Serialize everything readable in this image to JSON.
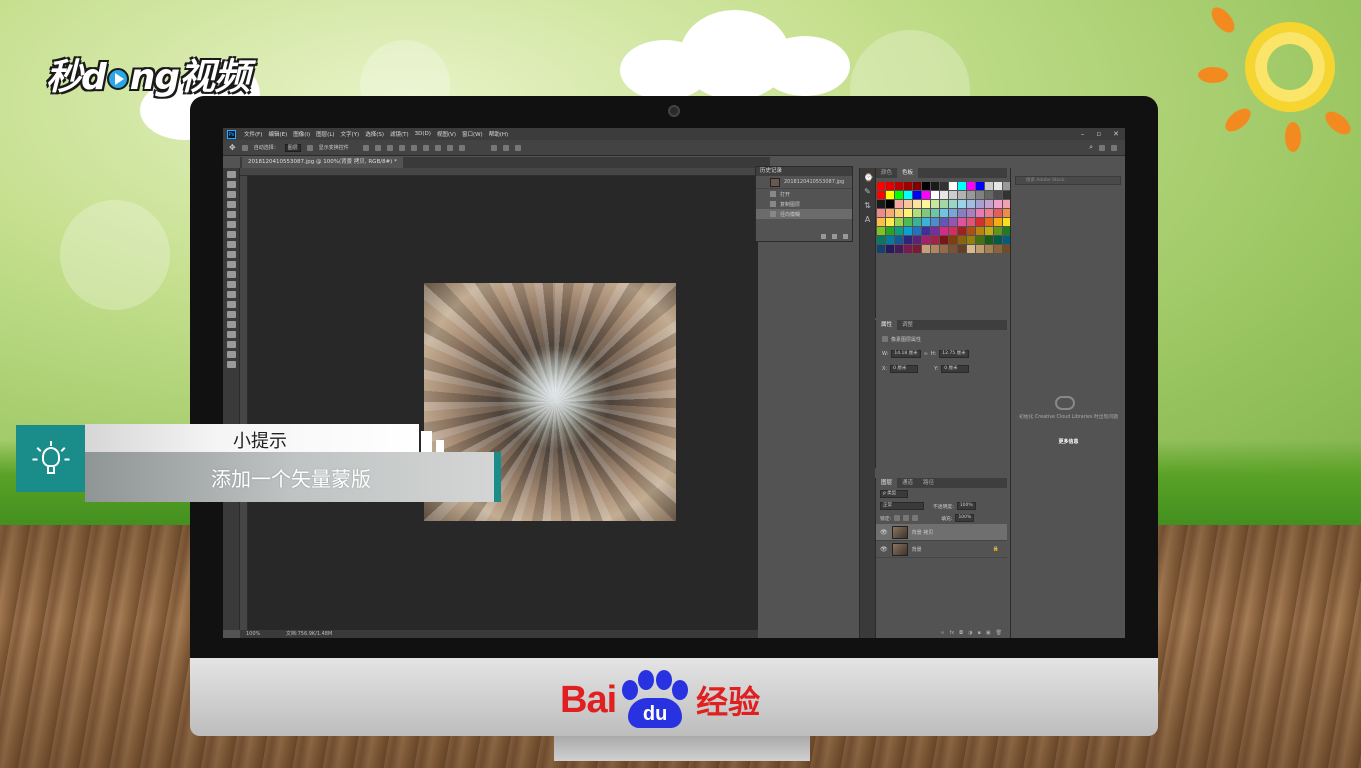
{
  "brand": {
    "logo_text_pre": "秒d",
    "logo_text_post": "ng视频",
    "baidu_left": "Bai",
    "baidu_paw": "du",
    "baidu_right": "经验"
  },
  "photoshop": {
    "menu": [
      "文件(F)",
      "编辑(E)",
      "图像(I)",
      "图层(L)",
      "文字(Y)",
      "选择(S)",
      "滤镜(T)",
      "3D(D)",
      "视图(V)",
      "窗口(W)",
      "帮助(H)"
    ],
    "window_controls": [
      "–",
      "▫",
      "✕"
    ],
    "options": {
      "auto_select_label": "自动选择：",
      "auto_select_value": "图层",
      "show_transform": "显示变换控件"
    },
    "document_tab": "20181204105530​87.jpg @ 100%(背景 拷贝, RGB/8#) *",
    "status": {
      "zoom": "100%",
      "doc_size": "文档:756.9K/1.48M"
    },
    "history": {
      "title": "历史记录",
      "snapshot": "2018120410553087.jpg",
      "steps": [
        "打开",
        "复制图层",
        "径向模糊"
      ],
      "active_step": 2
    },
    "swatches_tabs": [
      "颜色",
      "色板"
    ],
    "properties": {
      "tabs": [
        "属性",
        "调整"
      ],
      "section": "像素图层属性",
      "w_label": "W:",
      "w_value": "14.18 厘米",
      "h_label": "H:",
      "h_value": "12.75 厘米",
      "x_label": "X:",
      "x_value": "0 厘米",
      "y_label": "Y:",
      "y_value": "0 厘米",
      "link": "∞"
    },
    "layers": {
      "tabs": [
        "图层",
        "通道",
        "路径"
      ],
      "filter": "ρ 类型",
      "blend_mode": "正常",
      "opacity_label": "不透明度:",
      "opacity_value": "100%",
      "lock_label": "锁定:",
      "fill_label": "填充:",
      "fill_value": "100%",
      "items": [
        {
          "name": "背景 拷贝",
          "selected": true
        },
        {
          "name": "背景",
          "selected": false,
          "locked": true
        }
      ],
      "footer_icons": [
        "∞",
        "fx",
        "◘",
        "◑",
        "▪",
        "▣",
        "🗑"
      ]
    },
    "libraries": {
      "search_placeholder": "搜索 Adobe Stock",
      "message": "初始化 Creative Cloud Libraries 时出现问题",
      "link": "更多信息"
    }
  },
  "tip": {
    "title": "小提示",
    "text": "添加一个矢量蒙版"
  },
  "colors": {
    "teal_accent": "#1a8c8a",
    "baidu_red": "#e02020",
    "baidu_blue": "#2932e1",
    "ps_dark": "#535353"
  },
  "swatches": [
    "#ff0000",
    "#e00000",
    "#c00000",
    "#a00000",
    "#800000",
    "#000000",
    "#1a1a1a",
    "#333333",
    "#ffffff",
    "#00ffff",
    "#ff00ff",
    "#0000ff",
    "#cccccc",
    "#e6e6e6",
    "#999999",
    "#ff0000",
    "#ffff00",
    "#00ff00",
    "#00ffff",
    "#0000ff",
    "#ff00ff",
    "#ffffff",
    "#e6e6e6",
    "#cccccc",
    "#b3b3b3",
    "#999999",
    "#808080",
    "#666666",
    "#4d4d4d",
    "#333333",
    "#1a1a1a",
    "#000000",
    "#f5a3a3",
    "#f9c69b",
    "#fbe39c",
    "#fff59d",
    "#c9e7a1",
    "#a3d8a5",
    "#99d6c6",
    "#9bd4e9",
    "#a0bde4",
    "#a7a1d3",
    "#c5a0d0",
    "#eea2c9",
    "#f3a1b0",
    "#f08a8a",
    "#f6ab74",
    "#fbd177",
    "#fff078",
    "#b1dd7a",
    "#7fc97f",
    "#6cc6ac",
    "#6ec4e3",
    "#7aa5da",
    "#877ec4",
    "#ae7cc1",
    "#e77cb4",
    "#ec7c93",
    "#e65c5c",
    "#f28b46",
    "#f9c04a",
    "#ffeb4e",
    "#98d24f",
    "#52b852",
    "#3ab395",
    "#3bb2dc",
    "#4d8ccf",
    "#6457b3",
    "#9454b1",
    "#de529e",
    "#e35378",
    "#d42f2f",
    "#e66914",
    "#f3ad12",
    "#fde117",
    "#7cc421",
    "#27a527",
    "#0a9f7d",
    "#0aa0d4",
    "#2072c4",
    "#3f2ea0",
    "#7a2b9f",
    "#d42b8a",
    "#d82d5c",
    "#a31e1e",
    "#b0500f",
    "#b9840d",
    "#c1ac11",
    "#5f9519",
    "#1e7d1e",
    "#087960",
    "#087aa2",
    "#185796",
    "#30237a",
    "#5d2179",
    "#a22169",
    "#a52246",
    "#7a1616",
    "#843c0b",
    "#8b630a",
    "#91810d",
    "#476f13",
    "#165e16",
    "#065b48",
    "#065c7a",
    "#124270",
    "#241a5c",
    "#46195b",
    "#7a194f",
    "#7c1934",
    "#c7a07a",
    "#b08560",
    "#96694a",
    "#7c5234",
    "#643f26",
    "#d9b98e",
    "#c19c6c",
    "#a7804f",
    "#8c6439",
    "#714c27"
  ]
}
